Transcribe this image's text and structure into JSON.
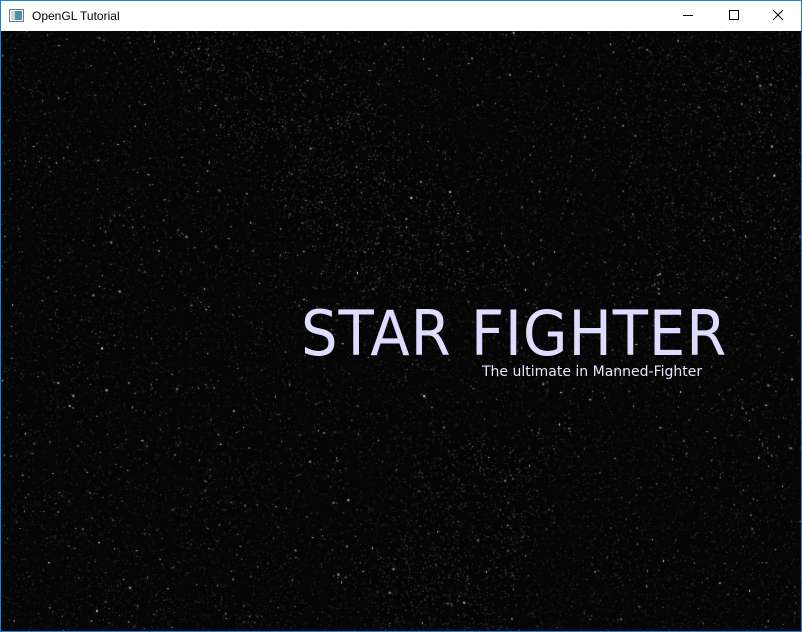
{
  "window": {
    "title": "OpenGL Tutorial",
    "controls": {
      "minimize": "minimize-icon",
      "maximize": "maximize-icon",
      "close": "close-icon"
    },
    "accent_color": "#1883d7"
  },
  "scene": {
    "background": "starfield",
    "title": "STAR FIGHTER",
    "subtitle": "The ultimate in Manned-Fighter",
    "title_color": "#dedcff"
  }
}
